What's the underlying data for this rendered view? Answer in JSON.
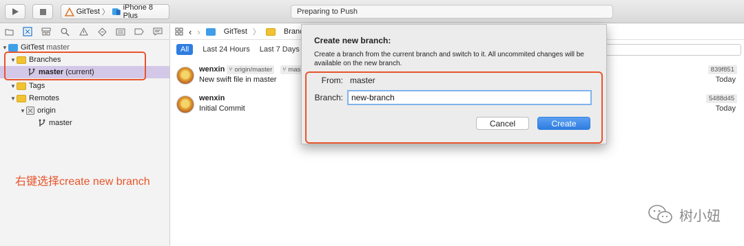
{
  "toolbar": {
    "scheme_project": "GitTest",
    "scheme_device": "iPhone 8 Plus",
    "status": "Preparing to Push"
  },
  "navigator": {
    "tabs": [
      "project-navigator-icon",
      "source-control-icon",
      "symbol-icon",
      "find-icon",
      "issue-icon",
      "test-icon",
      "debug-icon",
      "breakpoint-icon",
      "report-icon"
    ],
    "repo": "GitTest",
    "repo_branch": "master",
    "branches_label": "Branches",
    "current_branch": "master",
    "current_suffix": "(current)",
    "tags_label": "Tags",
    "remotes_label": "Remotes",
    "remote_name": "origin",
    "remote_branch": "master"
  },
  "annotation": {
    "text": "右键选择create new branch",
    "color": "#e8542b"
  },
  "editor": {
    "breadcrumb_project": "GitTest",
    "breadcrumb_folder": "Branche",
    "filters": [
      "All",
      "Last 24 Hours",
      "Last 7 Days"
    ],
    "commits": [
      {
        "author": "wenxin",
        "tag1": "origin/master",
        "tag2": "mas",
        "message": "New swift file in master",
        "sha": "839f851",
        "date": "Today"
      },
      {
        "author": "wenxin",
        "message": "Initial Commit",
        "sha": "5488d45",
        "date": "Today"
      }
    ]
  },
  "dialog": {
    "title": "Create new branch:",
    "description": "Create a branch from the current branch and switch to it. All uncommited changes will be available on the new branch.",
    "from_label": "From:",
    "from_value": "master",
    "branch_label": "Branch:",
    "branch_value": "new-branch",
    "cancel_label": "Cancel",
    "create_label": "Create",
    "accent_color": "#2f7de1"
  },
  "watermark": {
    "text": "树小妞"
  }
}
